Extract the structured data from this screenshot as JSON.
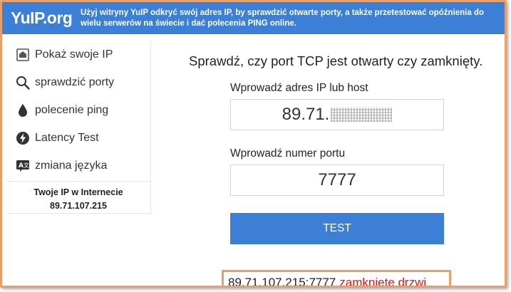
{
  "header": {
    "logo": "YuIP.org",
    "tagline": "Użyj witryny YuIP odkryć swój adres IP, by sprawdzić otwarte porty, a także przetestować opóźnienia do wielu serwerów na świecie i dać polecenia PING online."
  },
  "sidebar": {
    "items": [
      {
        "label": "Pokaż swoje IP",
        "icon": "router-icon"
      },
      {
        "label": "sprawdzić porty",
        "icon": "search-icon"
      },
      {
        "label": "polecenie ping",
        "icon": "drop-icon"
      },
      {
        "label": "Latency Test",
        "icon": "lightning-icon"
      },
      {
        "label": "zmiana języka",
        "icon": "translate-icon"
      }
    ],
    "ip_box": {
      "title": "Twoje IP w Internecie",
      "ip": "89.71.107.215"
    }
  },
  "main": {
    "title": "Sprawdź, czy port TCP jest otwarty czy zamknięty.",
    "host_label": "Wprowadź adres IP lub host",
    "host_value": "89.71.",
    "port_label": "Wprowadź numer portu",
    "port_value": "7777",
    "test_button": "TEST",
    "result": {
      "address": "89.71.107.215:7777",
      "status": "zamknięte drzwi"
    }
  },
  "colors": {
    "brand_blue": "#3b7fd6",
    "highlight_orange": "#e8a06a",
    "status_red": "#d11a1a"
  }
}
